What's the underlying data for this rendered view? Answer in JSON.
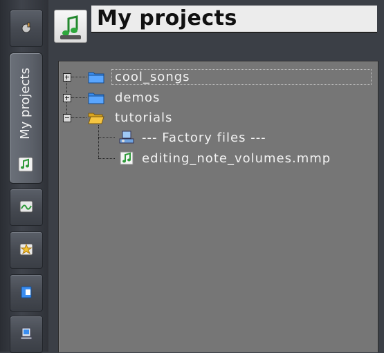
{
  "sidebar": {
    "active_tab_label": "My projects",
    "icons": [
      "instrument-plugin-icon",
      "my-projects-icon",
      "samples-icon",
      "presets-icon",
      "home-folder-icon",
      "computer-icon"
    ]
  },
  "header": {
    "title": "My projects"
  },
  "tree": {
    "items": [
      {
        "label": "cool_songs"
      },
      {
        "label": "demos"
      },
      {
        "label": "tutorials"
      },
      {
        "label": "--- Factory files ---"
      },
      {
        "label": "editing_note_volumes.mmp"
      }
    ]
  },
  "colors": {
    "panel_bg": "#767676",
    "folder_blue": "#3a8df0",
    "folder_yellow": "#f5c542",
    "title_bar": "#ececec"
  }
}
